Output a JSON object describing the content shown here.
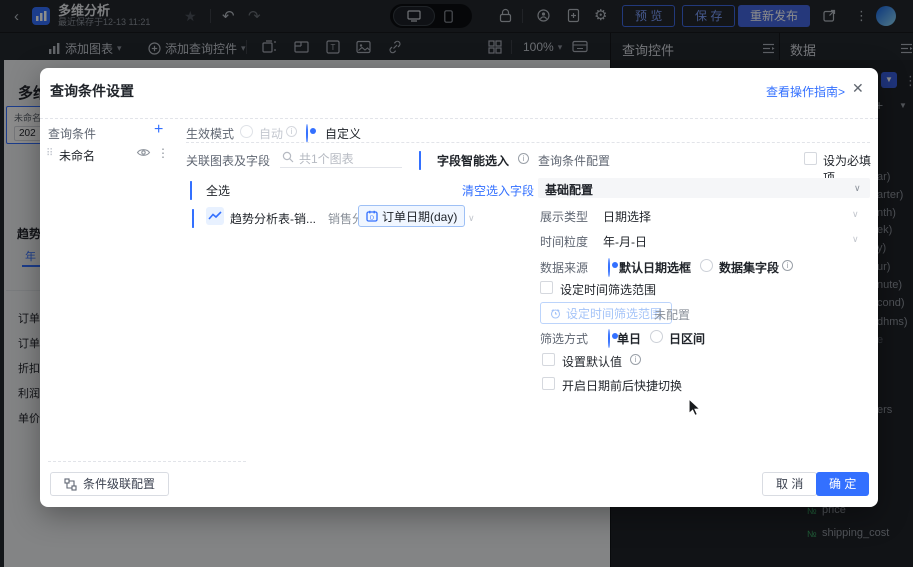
{
  "colors": {
    "accent": "#3370ff",
    "republish_btn": "#4466e0",
    "tag_bg": "#f0f6ff",
    "overlay": "rgba(0,0,0,0.45)",
    "number_field_green": "#3aa865"
  },
  "topbar": {
    "title": "多维分析",
    "subtitle": "最近保存于12-13 11:21",
    "preview": "预 览",
    "save": "保 存",
    "republish": "重新发布"
  },
  "toolbar": {
    "add_chart": "添加图表",
    "add_control": "添加查询控件",
    "zoom": "100%"
  },
  "panels": {
    "query_control": "查询控件",
    "data": "数据"
  },
  "canvas": {
    "title": "多维分析",
    "control_label": "未命名",
    "control_value": "202",
    "chart_title": "趋势",
    "tab": "年",
    "rows": [
      "订单",
      "订单",
      "折扣",
      "利润",
      "单价"
    ]
  },
  "datapanel": {
    "fields": [
      "ar)",
      "arter)",
      "nth)",
      "ek)",
      "y)",
      "ur)",
      "nute)",
      "cond)",
      "dhms)",
      "e",
      "ers"
    ],
    "measures": [
      {
        "icon": "№",
        "label": "price"
      },
      {
        "icon": "№",
        "label": "shipping_cost"
      }
    ]
  },
  "modal": {
    "title": "查询条件设置",
    "guide_link": "查看操作指南>",
    "close": "✕",
    "left": {
      "header": "查询条件",
      "add": "+",
      "item": "未命名"
    },
    "mode": {
      "label": "生效模式",
      "auto": "自动",
      "custom": "自定义"
    },
    "relation": {
      "label": "关联图表及字段",
      "placeholder": "共1个图表",
      "smart": "字段智能选入"
    },
    "select_all": "全选",
    "clear_link": "清空选入字段",
    "chart_row": {
      "name": "趋势分析表-销...",
      "dataset": "销售分析",
      "tag": "订单日期(day)"
    },
    "config": {
      "header": "查询条件配置",
      "required": "设为必填项",
      "basic": "基础配置",
      "display_label": "展示类型",
      "display_value": "日期选择",
      "granularity_label": "时间粒度",
      "granularity_value": "年-月-日",
      "source_label": "数据来源",
      "source_opt1": "默认日期选框",
      "source_opt2": "数据集字段",
      "range_checkbox": "设定时间筛选范围",
      "range_button": "设定时间筛选范围",
      "range_status": "未配置",
      "filter_label": "筛选方式",
      "filter_opt1": "单日",
      "filter_opt2": "日区间",
      "default_checkbox": "设置默认值",
      "quick_checkbox": "开启日期前后快捷切换"
    },
    "footer": {
      "cascade": "条件级联配置",
      "cancel": "取 消",
      "ok": "确 定"
    }
  },
  "icons": {
    "back": "chevron-left",
    "app": "bar-chart",
    "star": "star",
    "undo": "undo-arrow",
    "redo": "redo-arrow",
    "device": "desktop/phone",
    "lock": "lock",
    "globe": "globe",
    "doc": "document-add",
    "gear": "gear",
    "external": "external-link",
    "more": "kebab-menu",
    "search": "magnifier",
    "eye": "eye",
    "drag": "drag-handle",
    "calendar": "date-field",
    "number": "number-field"
  }
}
